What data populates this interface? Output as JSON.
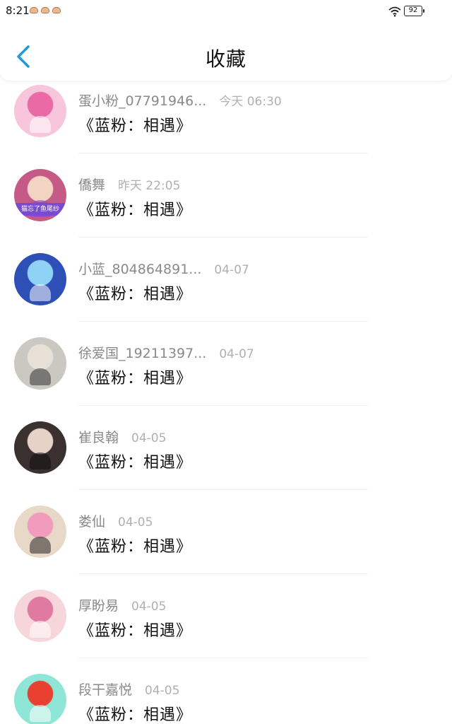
{
  "status_bar": {
    "time": "8:21",
    "battery": "92"
  },
  "header": {
    "title": "收藏"
  },
  "items": [
    {
      "name": "蛋小粉_07791946...",
      "date": "今天 06:30",
      "content": "《蓝粉：相遇》",
      "avatar_colors": [
        "#f7c5dc",
        "#e96aa5",
        "#ffffff"
      ]
    },
    {
      "name": "僑舞",
      "date": "昨天 22:05",
      "content": "《蓝粉：相遇》",
      "avatar_colors": [
        "#c65a86",
        "#f3d3c2",
        "#7a4ad0"
      ],
      "avatar_text": "猫忘了鱼尾纱"
    },
    {
      "name": "小蓝_804864891...",
      "date": "04-07",
      "content": "《蓝粉：相遇》",
      "avatar_colors": [
        "#2e4fb5",
        "#8fd2f5",
        "#ffffff"
      ]
    },
    {
      "name": "徐爱国_19211397...",
      "date": "04-07",
      "content": "《蓝粉：相遇》",
      "avatar_colors": [
        "#c9c9c2",
        "#e7e0d6",
        "#333333"
      ]
    },
    {
      "name": "崔良翰",
      "date": "04-05",
      "content": "《蓝粉：相遇》",
      "avatar_colors": [
        "#3a3030",
        "#e7d2c8",
        "#111111"
      ]
    },
    {
      "name": "娄仙",
      "date": "04-05",
      "content": "《蓝粉：相遇》",
      "avatar_colors": [
        "#e8d8c8",
        "#f19bbd",
        "#262626"
      ]
    },
    {
      "name": "厚盼易",
      "date": "04-05",
      "content": "《蓝粉：相遇》",
      "avatar_colors": [
        "#f6d6da",
        "#e07aa0",
        "#ffffff"
      ]
    },
    {
      "name": "段干嘉悦",
      "date": "04-05",
      "content": "《蓝粉：相遇》",
      "avatar_colors": [
        "#8fe6d6",
        "#e84132",
        "#ffffff"
      ]
    }
  ]
}
